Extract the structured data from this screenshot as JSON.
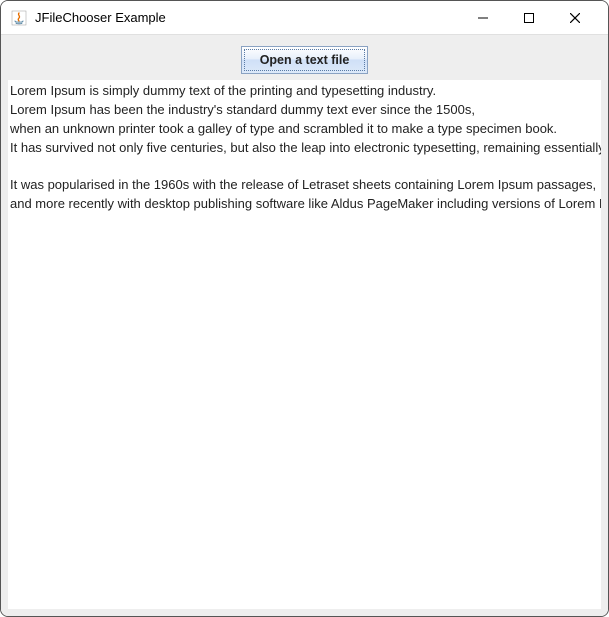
{
  "window": {
    "title": "JFileChooser Example"
  },
  "toolbar": {
    "open_button_label": "Open a text file"
  },
  "text_content": "Lorem Ipsum is simply dummy text of the printing and typesetting industry.\nLorem Ipsum has been the industry's standard dummy text ever since the 1500s,\nwhen an unknown printer took a galley of type and scrambled it to make a type specimen book.\nIt has survived not only five centuries, but also the leap into electronic typesetting, remaining essentially unchanged.\n\nIt was popularised in the 1960s with the release of Letraset sheets containing Lorem Ipsum passages,\nand more recently with desktop publishing software like Aldus PageMaker including versions of Lorem Ipsum."
}
